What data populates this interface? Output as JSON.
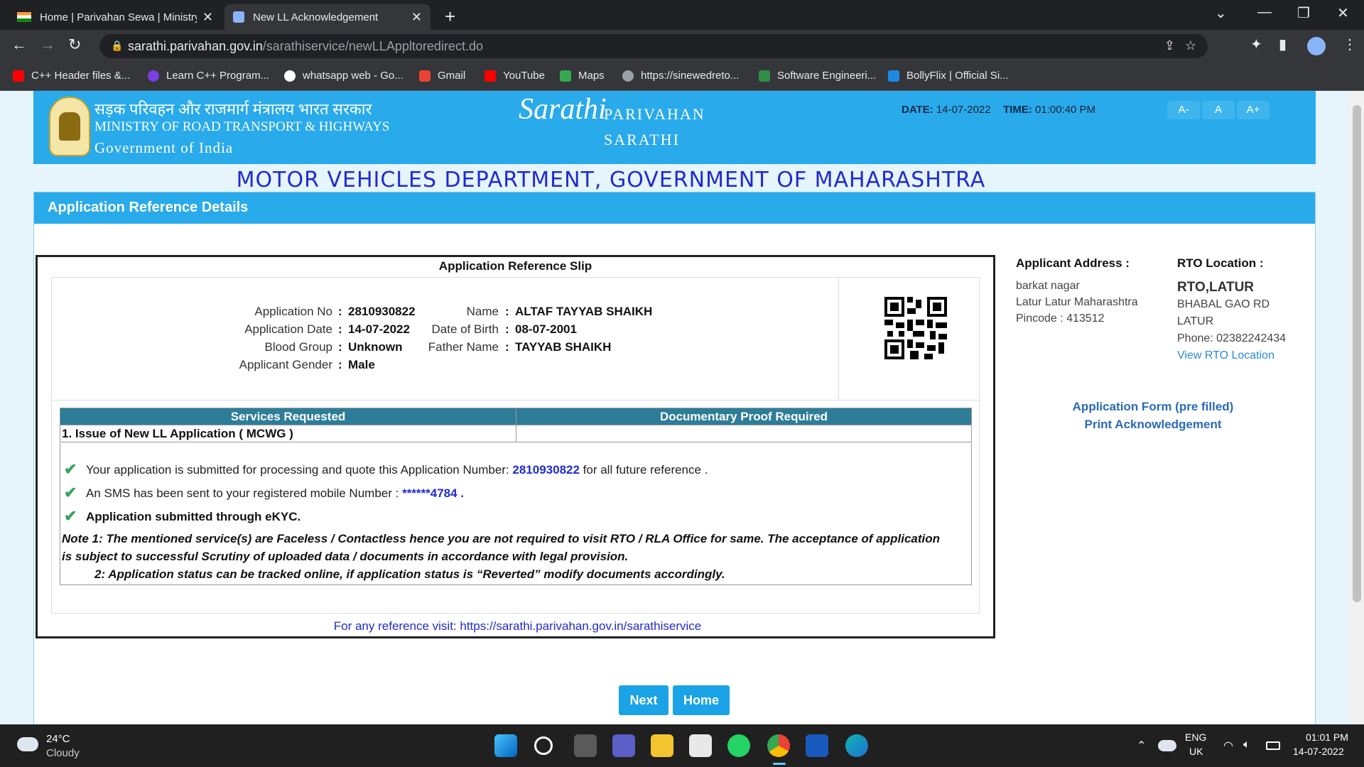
{
  "browser": {
    "tabs": [
      {
        "title": "Home | Parivahan Sewa | Ministry",
        "active": false
      },
      {
        "title": "New LL Acknowledgement",
        "active": true
      }
    ],
    "url_host": "sarathi.parivahan.gov.in",
    "url_path": "/sarathiservice/newLLAppltoredirect.do",
    "bookmarks": [
      {
        "label": "C++ Header files &...",
        "icon": "youtube-icon",
        "color": "#ff0000"
      },
      {
        "label": "Learn C++ Program...",
        "icon": "shield-icon",
        "color": "#7b3fe4"
      },
      {
        "label": "whatsapp web - Go...",
        "icon": "google-icon",
        "color": "#ffffff"
      },
      {
        "label": "Gmail",
        "icon": "gmail-icon",
        "color": "#ea4335"
      },
      {
        "label": "YouTube",
        "icon": "youtube-icon",
        "color": "#ff0000"
      },
      {
        "label": "Maps",
        "icon": "maps-icon",
        "color": "#34a853"
      },
      {
        "label": "https://sinewedreto...",
        "icon": "globe-icon",
        "color": "#9aa0a6"
      },
      {
        "label": "Software Engineeri...",
        "icon": "gfg-icon",
        "color": "#2f8d46"
      },
      {
        "label": "BollyFlix | Official Si...",
        "icon": "bollyflix-icon",
        "color": "#1e88e5"
      }
    ]
  },
  "header": {
    "hindi_line": "सड़क परिवहन और राजमार्ग मंत्रालय भारत सरकार",
    "ministry_line": "MINISTRY OF ROAD TRANSPORT & HIGHWAYS",
    "gov_line": "Government of India",
    "logo_text": "Sarathi",
    "parivahan": "PARIVAHAN",
    "sarathi": "SARATHI",
    "date_label": "DATE:",
    "date_value": "14-07-2022",
    "time_label": "TIME:",
    "time_value": "01:00:40 PM",
    "font_buttons": [
      "A-",
      "A",
      "A+"
    ]
  },
  "dept_title": "MOTOR VEHICLES DEPARTMENT, GOVERNMENT OF MAHARASHTRA",
  "panel_title": "Application Reference Details",
  "slip": {
    "title": "Application Reference Slip",
    "fields": {
      "app_no_label": "Application No",
      "app_no": "2810930822",
      "app_date_label": "Application Date",
      "app_date": "14-07-2022",
      "blood_label": "Blood Group",
      "blood": "Unknown",
      "gender_label": "Applicant Gender",
      "gender": "Male",
      "name_label": "Name",
      "name": "ALTAF TAYYAB SHAIKH",
      "dob_label": "Date of Birth",
      "dob": "08-07-2001",
      "father_label": "Father Name",
      "father": "TAYYAB SHAIKH",
      "colon": ":"
    },
    "table": {
      "headers": [
        "Services Requested",
        "Documentary Proof Required"
      ],
      "rows": [
        [
          "1. Issue of New LL Application ( MCWG )",
          ""
        ]
      ]
    },
    "messages": {
      "m1_pre": "Your application is submitted for processing and quote this Application Number: ",
      "m1_num": "2810930822",
      "m1_post": " for all future reference .",
      "m2_pre": "An SMS has been sent to your registered mobile Number : ",
      "m2_num": "******4784",
      "m2_post": " .",
      "m3": "Application submitted through eKYC.",
      "note1a": " Note 1:  The mentioned service(s) are Faceless / Contactless hence you are not required to visit RTO / RLA Office for same. The acceptance of application",
      "note1b": "is subject to successful Scrutiny of uploaded data / documents in accordance with legal provision.",
      "note2": "2:  Application status can be tracked online, if application status is “Reverted” modify documents accordingly."
    },
    "reference_visit": "For any reference visit: https://sarathi.parivahan.gov.in/sarathiservice"
  },
  "sidebar": {
    "address_head": "Applicant Address :",
    "address_lines": [
      "barkat nagar",
      "Latur Latur Maharashtra",
      "Pincode : 413512"
    ],
    "rto_head": "RTO Location :",
    "rto_name": "RTO,LATUR",
    "rto_lines": [
      "BHABAL GAO RD",
      "LATUR",
      "Phone:  02382242434"
    ],
    "rto_link": "View RTO Location",
    "form_link": "Application Form (pre filled)",
    "print_link": "Print Acknowledgement"
  },
  "buttons": {
    "next": "Next",
    "home": "Home"
  },
  "taskbar": {
    "temp": "24°C",
    "weather": "Cloudy",
    "lang1": "ENG",
    "lang2": "UK",
    "clock_time": "01:01 PM",
    "clock_date": "14-07-2022"
  },
  "colors": {
    "header_blue": "#29aaeb",
    "dept_title": "#1f2bd1",
    "table_head": "#2d7d99",
    "button": "#1aa3e6"
  }
}
